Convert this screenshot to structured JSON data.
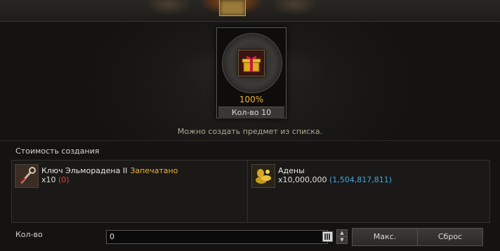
{
  "craft": {
    "success_rate": "100%",
    "quantity_label": "Кол-во 10",
    "hint": "Можно создать предмет из списка."
  },
  "cost": {
    "title": "Стоимость создания",
    "items": [
      {
        "name": "Ключ Эльморадена II",
        "tag": "Запечатано",
        "amount": "x10",
        "owned": "(0)",
        "icon": "key-icon"
      },
      {
        "name": "Адены",
        "amount": "x10,000,000",
        "owned": "(1,504,817,811)",
        "icon": "adena-icon"
      }
    ]
  },
  "quantity": {
    "label": "Кол-во",
    "value": "0"
  },
  "buttons": {
    "max": "Макс.",
    "reset": "Сброс"
  },
  "colors": {
    "accent_gold": "#f2b23a",
    "insufficient_red": "#e0443a",
    "owned_blue": "#3fa8e8"
  }
}
